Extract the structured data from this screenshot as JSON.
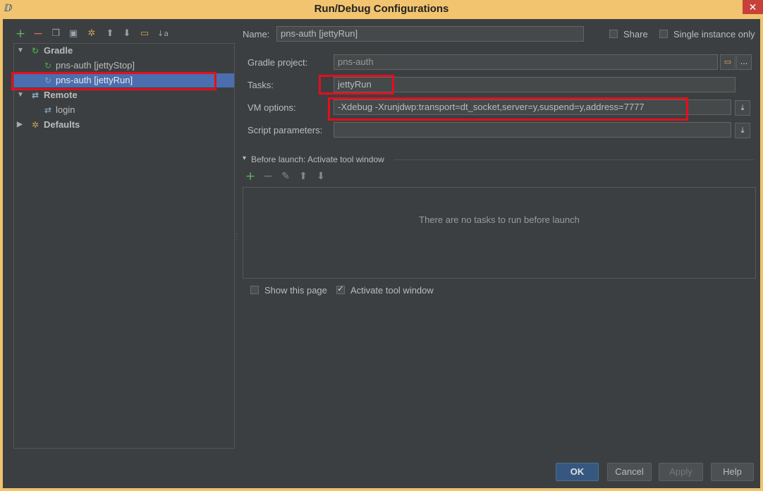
{
  "window": {
    "title": "Run/Debug Configurations",
    "close_glyph": "✕",
    "app_icon": "intellij-app-icon"
  },
  "left_toolbar": {
    "icons": [
      "add-icon",
      "remove-icon",
      "copy-icon",
      "save-icon",
      "wrench-icon",
      "move-up-icon",
      "move-down-icon",
      "folder-icon",
      "sort-icon"
    ]
  },
  "tree": {
    "gradle": {
      "label": "Gradle",
      "arrow": "▼"
    },
    "jetty_stop": {
      "label": "pns-auth [jettyStop]"
    },
    "jetty_run": {
      "label": "pns-auth [jettyRun]"
    },
    "remote": {
      "label": "Remote",
      "arrow": "▼"
    },
    "login": {
      "label": "login"
    },
    "defaults": {
      "label": "Defaults",
      "arrow": "▶"
    }
  },
  "form": {
    "name_label": "Name:",
    "name_value": "pns-auth [jettyRun]",
    "share_label": "Share",
    "share_checked": false,
    "single_instance_label": "Single instance only",
    "single_instance_checked": false,
    "gradle_project_label": "Gradle project:",
    "gradle_project_value": "pns-auth",
    "tasks_label": "Tasks:",
    "tasks_value": "jettyRun",
    "vm_options_label": "VM options:",
    "vm_options_value": "-Xdebug -Xrunjdwp:transport=dt_socket,server=y,suspend=y,address=7777",
    "script_params_label": "Script parameters:",
    "script_params_value": "",
    "browse_glyph": "...",
    "expand_glyph": "⤓"
  },
  "before_launch": {
    "header": "Before launch: Activate tool window",
    "arrow": "▾",
    "empty_text": "There are no tasks to run before launch",
    "show_page_label": "Show this page",
    "show_page_checked": false,
    "activate_label": "Activate tool window",
    "activate_checked": true
  },
  "buttons": {
    "ok": "OK",
    "cancel": "Cancel",
    "apply": "Apply",
    "help": "Help"
  },
  "colors": {
    "title_bar": "#f2c46f",
    "dialog_bg": "#3c3f41",
    "selection": "#4b6eaf",
    "highlight_box": "#e30f1d",
    "gradle_green": "#4aa449"
  }
}
